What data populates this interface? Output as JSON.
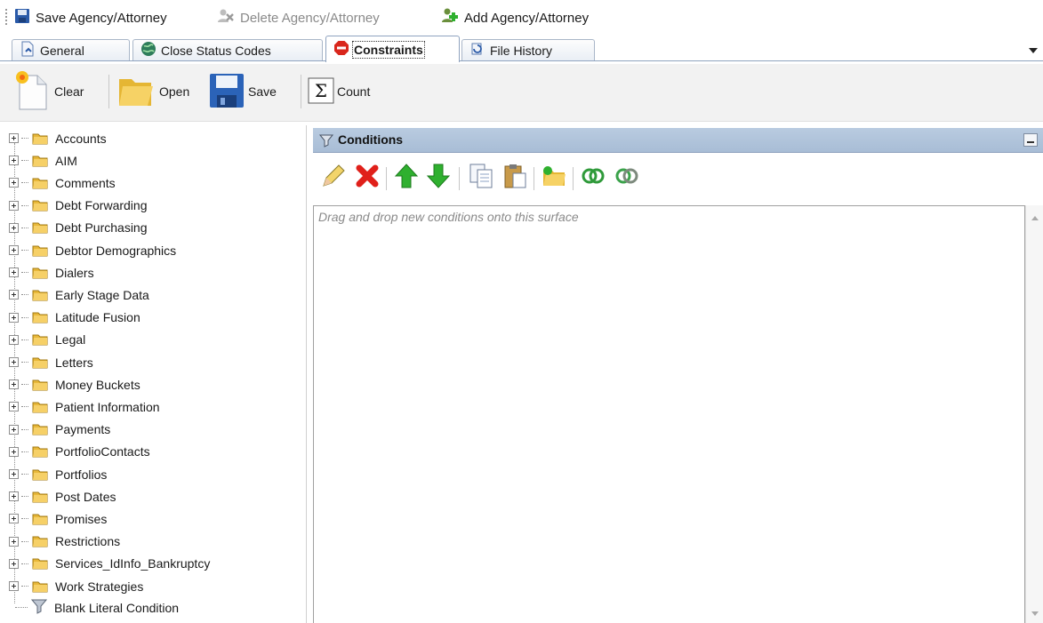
{
  "commands": {
    "save_label": "Save Agency/Attorney",
    "delete_label": "Delete Agency/Attorney",
    "add_label": "Add Agency/Attorney"
  },
  "tabs": [
    {
      "label": "General",
      "icon": "document-icon"
    },
    {
      "label": "Close Status Codes",
      "icon": "globe-icon"
    },
    {
      "label": "Constraints",
      "icon": "stop-icon",
      "active": true
    },
    {
      "label": "File History",
      "icon": "history-icon"
    }
  ],
  "toolbar": {
    "clear_label": "Clear",
    "open_label": "Open",
    "save_label": "Save",
    "count_label": "Count"
  },
  "tree": {
    "items": [
      "Accounts",
      "AIM",
      "Comments",
      "Debt Forwarding",
      "Debt Purchasing",
      "Debtor Demographics",
      "Dialers",
      "Early Stage Data",
      "Latitude Fusion",
      "Legal",
      "Letters",
      "Money Buckets",
      "Patient Information",
      "Payments",
      "PortfolioContacts",
      "Portfolios",
      "Post Dates",
      "Promises",
      "Restrictions",
      "Services_IdInfo_Bankruptcy",
      "Work Strategies"
    ],
    "leaf": "Blank Literal Condition"
  },
  "conditions": {
    "title": "Conditions",
    "hint": "Drag and drop new conditions onto this surface"
  },
  "colors": {
    "panel_header": "#b2c5dc",
    "folder": "#e8b83a",
    "delete_red": "#e0201a",
    "arrow_green": "#2fb02f"
  }
}
